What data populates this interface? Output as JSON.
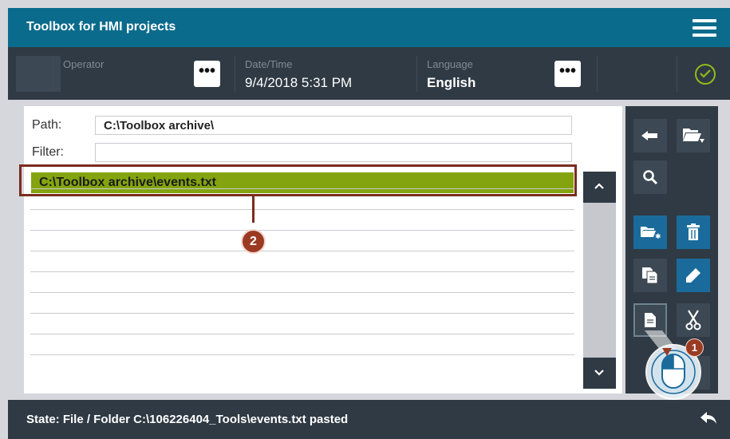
{
  "header": {
    "title": "Toolbox for HMI projects",
    "menu_icon": "hamburger-menu-icon"
  },
  "infobar": {
    "operator": {
      "label": "Operator",
      "value": ""
    },
    "datetime": {
      "label": "Date/Time",
      "value": "9/4/2018 5:31 PM"
    },
    "language": {
      "label": "Language",
      "value": "English"
    },
    "dots": "•••",
    "ok_icon": "check-circle-icon"
  },
  "browser": {
    "path_label": "Path:",
    "path_value": "C:\\Toolbox archive\\",
    "filter_label": "Filter:",
    "filter_value": "",
    "selected_item": "C:\\Toolbox archive\\events.txt",
    "empty_rows": 9
  },
  "callouts": {
    "one": "1",
    "two": "2"
  },
  "tools": [
    "back-arrow-icon",
    "folder-download-icon",
    "search-icon",
    "new-folder-icon",
    "trash-icon",
    "copy-icon",
    "rename-pencil-icon",
    "paste-icon",
    "cut-scissors-icon"
  ],
  "status": {
    "text": "State: File / Folder C:\\106226404_Tools\\events.txt pasted",
    "back_icon": "reply-arrow-icon"
  },
  "colors": {
    "header": "#0a6b8c",
    "dark": "#2f3a44",
    "selection": "#83a40e",
    "callout": "#9b3a22",
    "tool_blue": "#1a6b9b",
    "ok_green": "#8fbd1a"
  }
}
